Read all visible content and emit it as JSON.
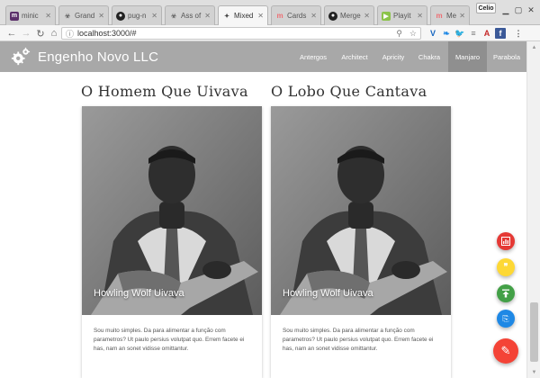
{
  "browser": {
    "tabs": [
      {
        "label": "minic",
        "icon": "m-letter-icon",
        "color": "#5b2f6a"
      },
      {
        "label": "Grand",
        "icon": "biohazard-icon",
        "color": "#666666"
      },
      {
        "label": "pug-n",
        "icon": "github-icon",
        "color": "#222222"
      },
      {
        "label": "Ass of",
        "icon": "biohazard-icon",
        "color": "#666666"
      },
      {
        "label": "Mixed",
        "icon": "compass-icon",
        "color": "#444444"
      },
      {
        "label": "Cards",
        "icon": "materialize-icon",
        "color": "#ee6e73"
      },
      {
        "label": "Merge",
        "icon": "github-icon",
        "color": "#222222"
      },
      {
        "label": "Playit",
        "icon": "playit-icon",
        "color": "#8bc34a"
      },
      {
        "label": "Media",
        "icon": "materialize-icon",
        "color": "#ee6e73"
      }
    ],
    "profile": "Celio",
    "url": "localhost:3000/#"
  },
  "app": {
    "title": "Engenho Novo LLC",
    "menu": [
      "Antergos",
      "Architect",
      "Apricity",
      "Chakra",
      "Manjaro",
      "Parabola"
    ],
    "active_menu": "Manjaro"
  },
  "cards": [
    {
      "title": "O Homem Que Uivava",
      "caption": "Howling Wolf Uivava",
      "text": "Sou muito simples. Da para alimentar a função com parametros? Ut paulo persius volutpat quo. Errem facete ei has, nam an sonet vidisse omittantur."
    },
    {
      "title": "O Lobo Que Cantava",
      "caption": "Howling Wolf Uivava",
      "text": "Sou muito simples. Da para alimentar a função com parametros? Ut paulo persius volutpat quo. Errem facete ei has, nam an sonet vidisse omittantur."
    }
  ],
  "fabs": [
    {
      "icon": "chart-icon",
      "color": "#e53935"
    },
    {
      "icon": "quote-icon",
      "color": "#fdd835"
    },
    {
      "icon": "publish-icon",
      "color": "#43a047"
    },
    {
      "icon": "attach-icon",
      "color": "#1e88e5"
    },
    {
      "icon": "edit-icon",
      "color": "#f44336"
    }
  ]
}
